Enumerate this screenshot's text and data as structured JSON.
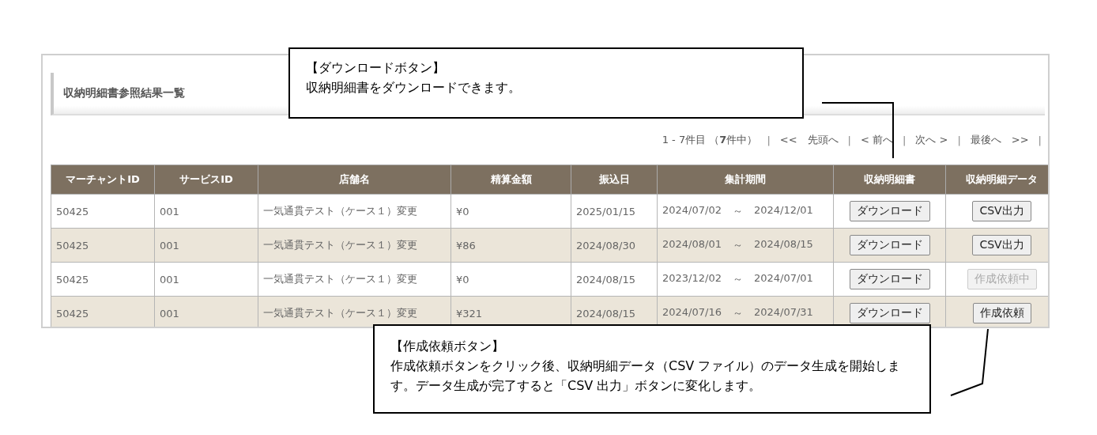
{
  "panel": {
    "title": "収納明細書参照結果一覧"
  },
  "pagination": [
    {
      "kind": "info",
      "text": "1 - 7件目 （**7**件中）"
    },
    {
      "kind": "sep",
      "text": "|"
    },
    {
      "kind": "link",
      "text": "<<　先頭へ"
    },
    {
      "kind": "sep",
      "text": "|"
    },
    {
      "kind": "link",
      "text": "< 前へ"
    },
    {
      "kind": "sep",
      "text": "|"
    },
    {
      "kind": "link",
      "text": "次へ >"
    },
    {
      "kind": "sep",
      "text": "|"
    },
    {
      "kind": "link",
      "text": "最後へ　>>"
    },
    {
      "kind": "sep",
      "text": "|"
    }
  ],
  "table": {
    "columns": [
      "マーチャントID",
      "サービスID",
      "店舗名",
      "精算金額",
      "振込日",
      "集計期間",
      "収納明細書",
      "収納明細データ"
    ],
    "rows": [
      {
        "merchant_id": "50425",
        "service_id": "001",
        "store": "一気通貫テスト（ケース１）変更",
        "amount": "¥0",
        "transfer_date": "2025/01/15",
        "period_from": "2024/07/02",
        "period_sep": "～",
        "period_to": "2024/12/01",
        "download": "ダウンロード",
        "data_button": {
          "label": "CSV出力",
          "disabled": false
        }
      },
      {
        "merchant_id": "50425",
        "service_id": "001",
        "store": "一気通貫テスト（ケース１）変更",
        "amount": "¥86",
        "transfer_date": "2024/08/30",
        "period_from": "2024/08/01",
        "period_sep": "～",
        "period_to": "2024/08/15",
        "download": "ダウンロード",
        "data_button": {
          "label": "CSV出力",
          "disabled": false
        }
      },
      {
        "merchant_id": "50425",
        "service_id": "001",
        "store": "一気通貫テスト（ケース１）変更",
        "amount": "¥0",
        "transfer_date": "2024/08/15",
        "period_from": "2023/12/02",
        "period_sep": "～",
        "period_to": "2024/07/01",
        "download": "ダウンロード",
        "data_button": {
          "label": "作成依頼中",
          "disabled": true
        }
      },
      {
        "merchant_id": "50425",
        "service_id": "001",
        "store": "一気通貫テスト（ケース１）変更",
        "amount": "¥321",
        "transfer_date": "2024/08/15",
        "period_from": "2024/07/16",
        "period_sep": "～",
        "period_to": "2024/07/31",
        "download": "ダウンロード",
        "data_button": {
          "label": "作成依頼",
          "disabled": false
        }
      }
    ]
  },
  "callouts": [
    {
      "title": "【ダウンロードボタン】",
      "text": "収納明細書をダウンロードできます。"
    },
    {
      "title": "【作成依頼ボタン】",
      "text": "作成依頼ボタンをクリック後、収納明細データ（CSV ファイル）のデータ生成を開始します。データ生成が完了すると「CSV 出力」ボタンに変化します。"
    }
  ]
}
